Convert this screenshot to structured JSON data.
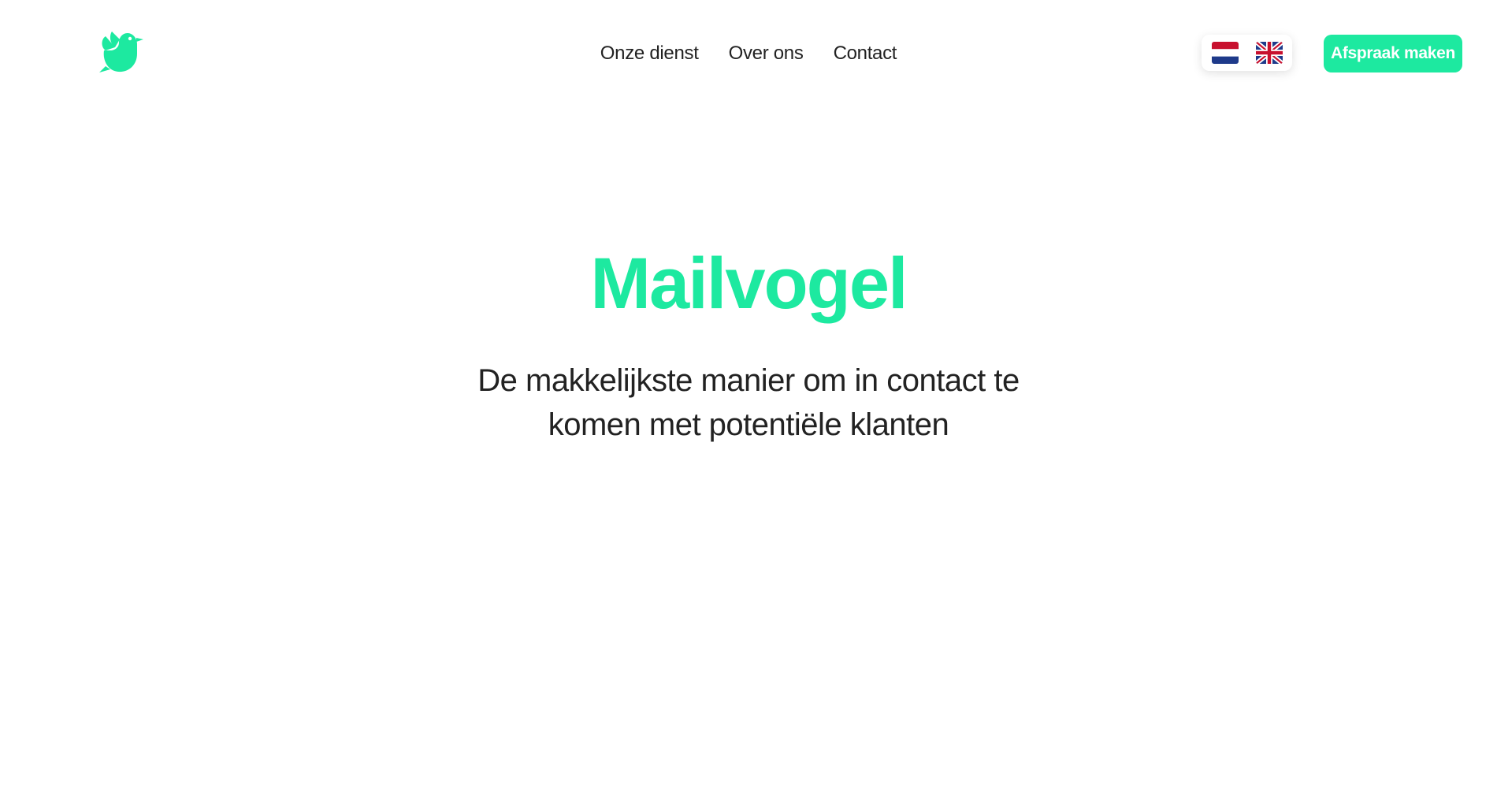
{
  "brand": {
    "logo_icon": "bird-icon",
    "accent_color": "#1de9a0"
  },
  "nav": {
    "items": [
      {
        "label": "Onze dienst"
      },
      {
        "label": "Over ons"
      },
      {
        "label": "Contact"
      }
    ]
  },
  "language_switcher": {
    "options": [
      {
        "icon": "flag-netherlands-icon"
      },
      {
        "icon": "flag-united-kingdom-icon"
      }
    ]
  },
  "cta": {
    "label": "Afspraak maken"
  },
  "hero": {
    "title": "Mailvogel",
    "subtitle": "De makkelijkste manier om in contact te komen met potentiële klanten"
  }
}
